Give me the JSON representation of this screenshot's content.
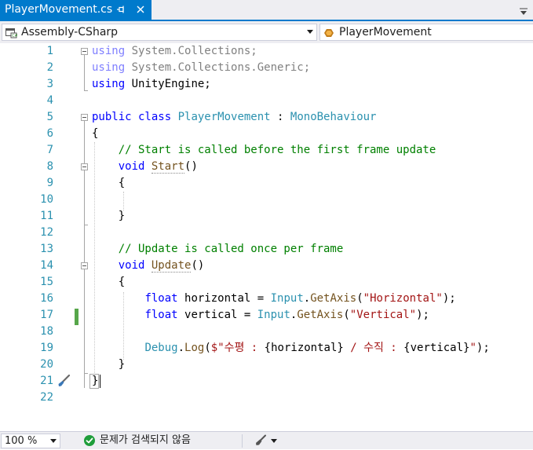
{
  "tab": {
    "title": "PlayerMovement.cs",
    "pin_glyph": "⊸",
    "close_glyph": "✕",
    "pin_icon": "pin-icon",
    "close_icon": "close-icon",
    "dropdown_icon": "tab-list-dropdown-icon"
  },
  "navbar": {
    "project": "Assembly-CSharp",
    "project_icon": "csharp-project-icon",
    "class_name": "PlayerMovement",
    "class_icon": "class-icon"
  },
  "editor": {
    "line_numbers": [
      "1",
      "2",
      "3",
      "4",
      "5",
      "6",
      "7",
      "8",
      "9",
      "10",
      "11",
      "12",
      "13",
      "14",
      "15",
      "16",
      "17",
      "18",
      "19",
      "20",
      "21",
      "22"
    ],
    "tokens": {
      "l1_kw": "using",
      "l1_ns": " System.Collections;",
      "l2_kw": "using",
      "l2_ns": " System.Collections.Generic;",
      "l3_kw": "using",
      "l3_ns": " UnityEngine;",
      "l5_kw1": "public",
      "l5_kw2": " class ",
      "l5_type": "PlayerMovement",
      "l5_sep": " : ",
      "l5_base": "MonoBehaviour",
      "l6_brace": "{",
      "l7_comment": "    // Start is called before the first frame update",
      "l8_indent": "    ",
      "l8_kw": "void",
      "l8_sp": " ",
      "l8_method": "Start",
      "l8_parens": "()",
      "l9_brace": "    {",
      "l11_brace": "    }",
      "l13_comment": "    // Update is called once per frame",
      "l14_indent": "    ",
      "l14_kw": "void",
      "l14_sp": " ",
      "l14_method": "Update",
      "l14_parens": "()",
      "l15_brace": "    {",
      "l16_indent": "        ",
      "l16_kw": "float",
      "l16_var": " horizontal = ",
      "l16_type": "Input",
      "l16_dot": ".",
      "l16_method": "GetAxis",
      "l16_open": "(",
      "l16_str": "\"Horizontal\"",
      "l16_close": ");",
      "l17_indent": "        ",
      "l17_kw": "float",
      "l17_var": " vertical = ",
      "l17_type": "Input",
      "l17_dot": ".",
      "l17_method": "GetAxis",
      "l17_open": "(",
      "l17_str": "\"Vertical\"",
      "l17_close": ");",
      "l19_indent": "        ",
      "l19_type": "Debug",
      "l19_dot": ".",
      "l19_method": "Log",
      "l19_open": "(",
      "l19_str1": "$\"수평 : ",
      "l19_interp1": "{horizontal}",
      "l19_str2": " / 수직 : ",
      "l19_interp2": "{vertical}",
      "l19_str3": "\"",
      "l19_close": ");",
      "l20_brace": "    }",
      "l21_brace": "}"
    },
    "changed_lines": [
      "17"
    ],
    "quick_action_icon": "paintbrush-icon"
  },
  "statusbar": {
    "zoom": "100 %",
    "issues_text": "문제가 검색되지 않음",
    "issues_icon": "check-circle-icon",
    "cleanup_icon": "code-cleanup-brush-icon"
  },
  "colors": {
    "accent": "#007acc",
    "keyword": "#0000ff",
    "type": "#2b91af",
    "comment": "#008000",
    "string": "#a31515",
    "method": "#74531f",
    "line_number": "#2b91af",
    "change_bar": "#57a64a",
    "status_ok": "#1f9d3a"
  }
}
